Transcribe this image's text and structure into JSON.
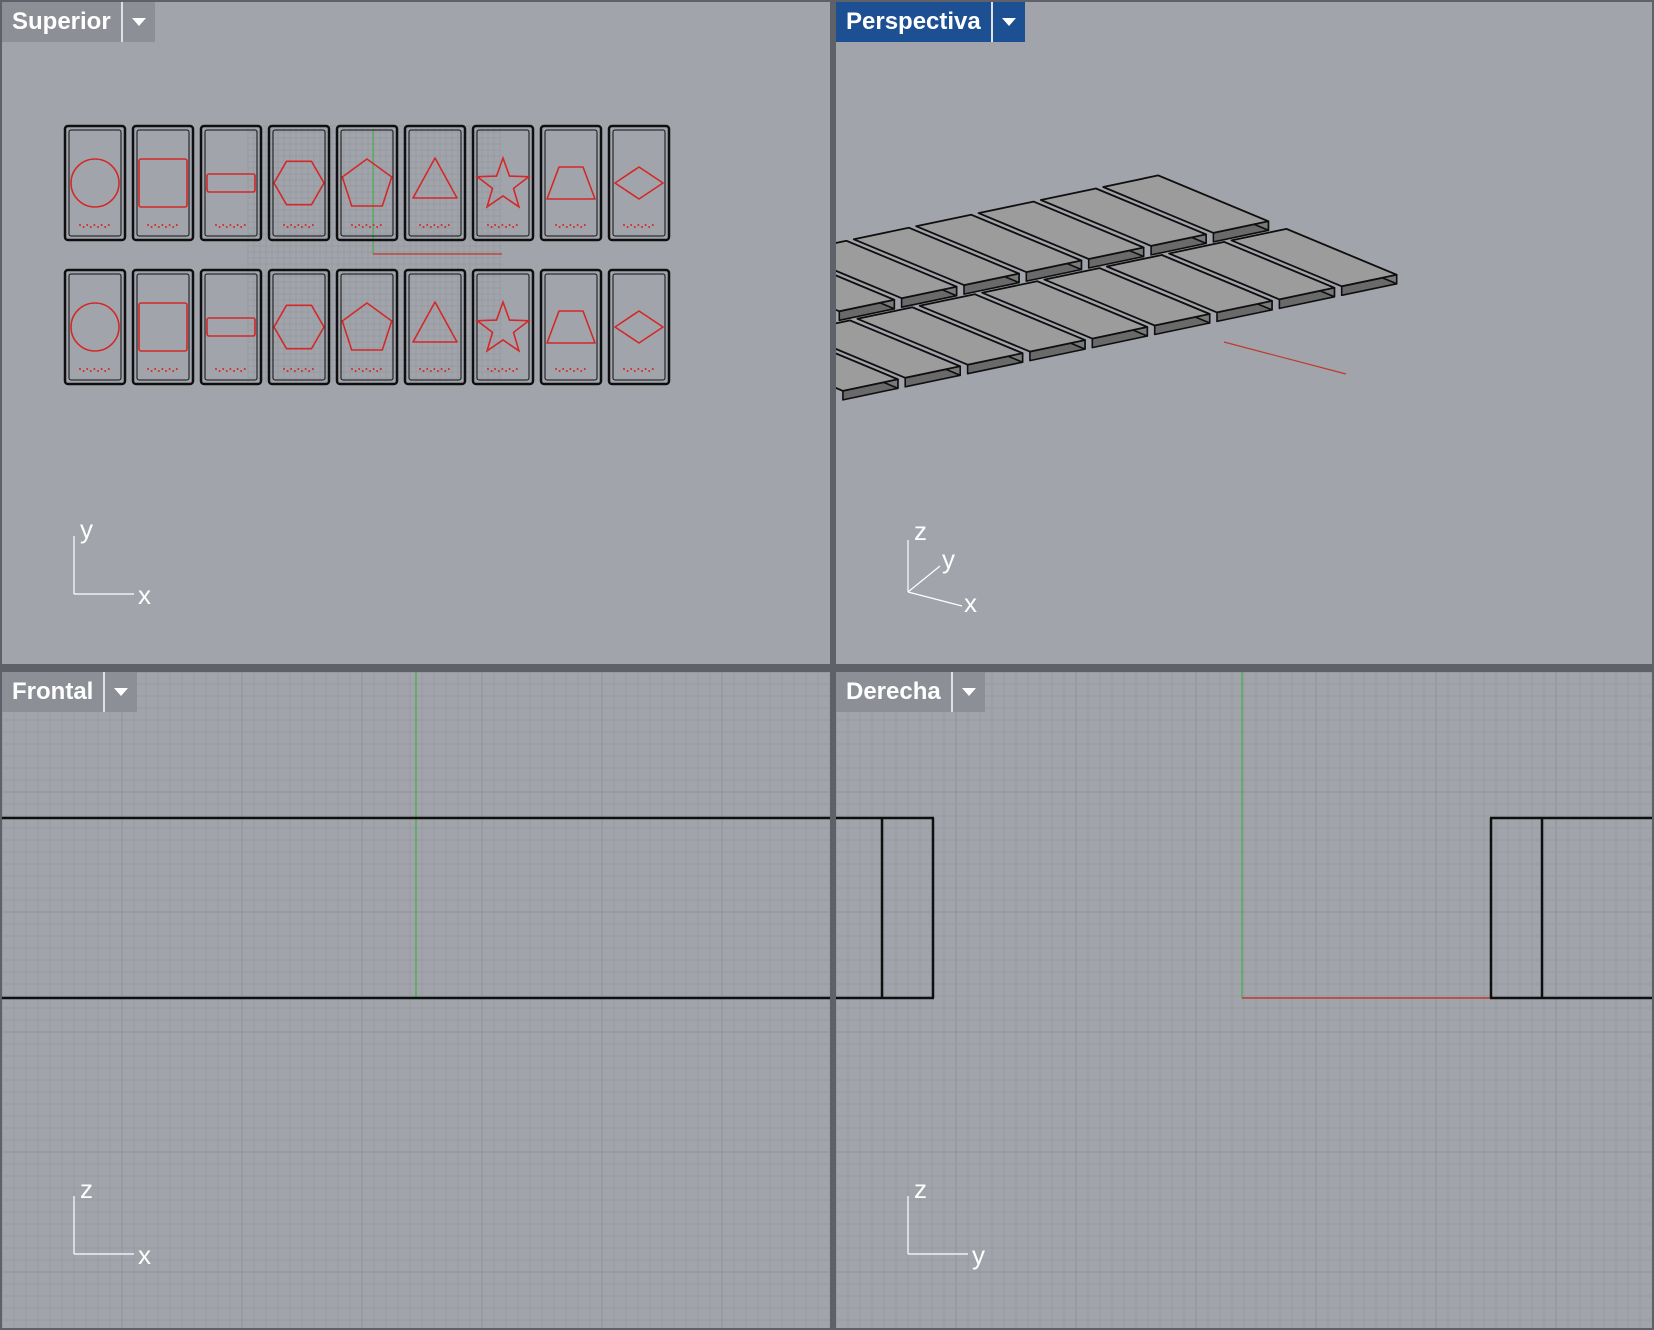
{
  "colors": {
    "background": "#a1a5ab",
    "grid_minor": "#969aa0",
    "grid_major": "#8e9298",
    "tab_inactive": "#8c9096",
    "tab_active": "#1d4f93",
    "edge": "#0f0f0f",
    "curve": "#d42828",
    "axis_y": "#4caf50",
    "axis_x": "#c0392b",
    "box_top": "#9c9c9c",
    "box_side": "#6a6a6a"
  },
  "viewports": {
    "top": {
      "title": "Superior",
      "active": false,
      "axes": {
        "vertical": "y",
        "horizontal": "x"
      }
    },
    "persp": {
      "title": "Perspectiva",
      "active": true,
      "axes": {
        "up": "z",
        "depth": "y",
        "horizontal": "x"
      }
    },
    "front": {
      "title": "Frontal",
      "active": false,
      "axes": {
        "vertical": "z",
        "horizontal": "x"
      }
    },
    "right": {
      "title": "Derecha",
      "active": false,
      "axes": {
        "vertical": "z",
        "horizontal": "y"
      }
    }
  },
  "cards": {
    "rows": 2,
    "shapes": [
      "circle-icon",
      "square-icon",
      "rectangle-icon",
      "hexagon-icon",
      "pentagon-icon",
      "triangle-icon",
      "star-icon",
      "trapezoid-icon",
      "diamond-icon"
    ]
  }
}
